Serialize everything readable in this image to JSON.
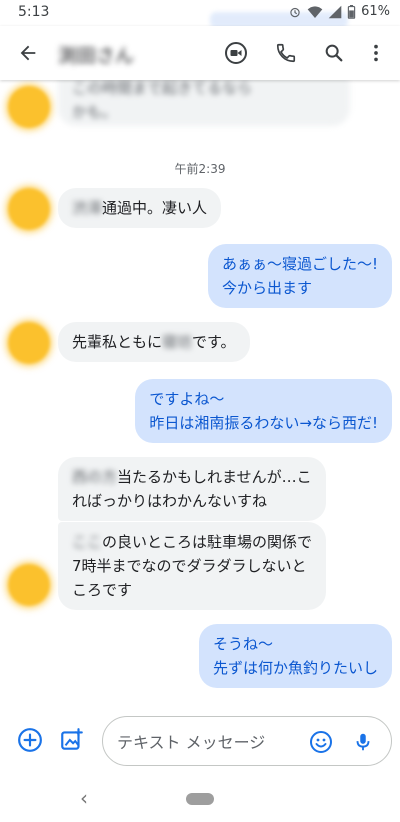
{
  "status_bar": {
    "time": "5:13",
    "battery": "61%"
  },
  "header": {
    "contact_name": "渕田さん"
  },
  "conversation": {
    "timestamp": "午前2:39",
    "messages": [
      {
        "dir": "in",
        "lines": [
          "この時間まで起きてるなら",
          "かも。"
        ]
      },
      {
        "dir": "in",
        "redacted": "渋滞",
        "text": "通過中。凄い人"
      },
      {
        "dir": "out",
        "lines": [
          "あぁぁ〜寝過ごした〜!",
          "今から出ます"
        ]
      },
      {
        "dir": "in",
        "text_before": "先輩私ともに",
        "redacted": "寝坊",
        "text_after": "です。"
      },
      {
        "dir": "out",
        "lines": [
          "ですよね〜",
          "昨日は湘南振るわない→なら西だ!"
        ]
      },
      {
        "dir": "in",
        "redacted": "西の方",
        "lines": [
          "当たるかもしれませんが…こ",
          "ればっかりはわかんないすね"
        ]
      },
      {
        "dir": "in",
        "redacted": "ここ",
        "lines": [
          "の良いところは駐車場の関係で",
          "7時半までなのでダラダラしないと",
          "ころです"
        ]
      },
      {
        "dir": "out",
        "lines": [
          "そうね〜",
          "先ずは何か魚釣りたいし"
        ]
      }
    ]
  },
  "composer": {
    "placeholder": "テキスト メッセージ"
  },
  "icons": {
    "back": "arrow-back-icon",
    "video": "video-call-icon",
    "call": "phone-icon",
    "search": "search-icon",
    "more": "more-vert-icon",
    "add": "add-circle-icon",
    "attach": "gallery-icon",
    "emoji": "emoji-icon",
    "mic": "mic-icon"
  },
  "colors": {
    "accent": "#1a73e8",
    "outgoing_bubble": "#d3e3fd",
    "outgoing_text": "#0b57d0",
    "incoming_bubble": "#f1f3f4",
    "avatar": "#fbc12d"
  }
}
